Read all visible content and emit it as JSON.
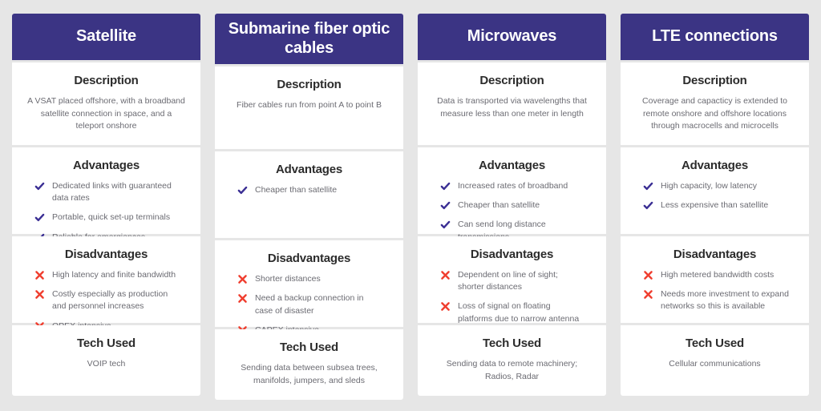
{
  "theme": {
    "page_background": "#e6e6e6",
    "card_background": "#ffffff",
    "header_purple": "#3b3484",
    "check_color": "#3b2f94",
    "cross_color": "#f03e2f",
    "title_color": "#2c2c2c",
    "body_color": "#6b6b72"
  },
  "section_labels": {
    "description": "Description",
    "advantages": "Advantages",
    "disadvantages": "Disadvantages",
    "tech_used": "Tech Used"
  },
  "columns": [
    {
      "title": "Satellite",
      "description": "A VSAT placed offshore, with a broadband satellite connection in space, and a teleport onshore",
      "advantages": [
        "Dedicated links with guaranteed data rates",
        "Portable, quick set-up terminals",
        "Reliable for emergiences"
      ],
      "disadvantages": [
        "High latency and finite bandwidth",
        "Costly especially as production and personnel increases",
        "OPEX intensive"
      ],
      "tech_used": "VOIP tech"
    },
    {
      "title": "Submarine fiber optic cables",
      "description": "Fiber cables run from point A to point B",
      "advantages": [
        "Cheaper than satellite"
      ],
      "disadvantages": [
        "Shorter distances",
        "Need a backup connection in case of disaster",
        "CAPEX intensive"
      ],
      "tech_used": "Sending data between subsea trees, manifolds, jumpers, and sleds"
    },
    {
      "title": "Microwaves",
      "description": "Data is transported via wavelengths that measure less than one meter in length",
      "advantages": [
        "Increased rates of broadband",
        "Cheaper than satellite",
        "Can send long distance transmissions"
      ],
      "disadvantages": [
        "Dependent on line of sight; shorter distances",
        "Loss of signal on floating platforms due to narrow antenna beam widths"
      ],
      "tech_used": "Sending data to remote machinery; Radios, Radar"
    },
    {
      "title": "LTE connections",
      "description": "Coverage and capacticy is extended to remote onshore and offshore locations through macrocells and microcells",
      "advantages": [
        "High capacity, low latency",
        "Less expensive than satellite"
      ],
      "disadvantages": [
        "High metered bandwidth costs",
        "Needs more investment to expand networks so this is available"
      ],
      "tech_used": "Cellular communications"
    }
  ]
}
